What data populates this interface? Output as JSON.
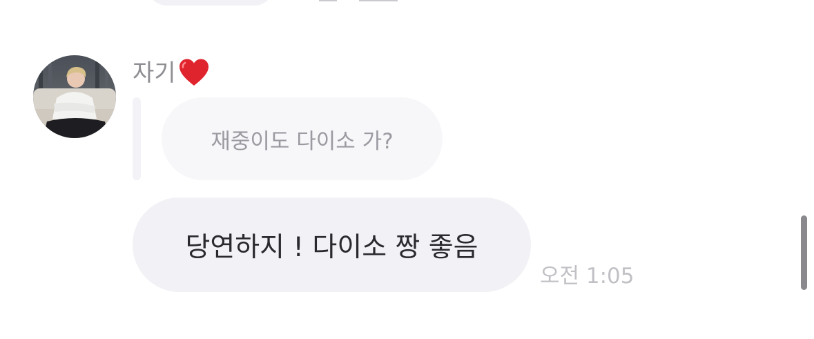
{
  "sender": {
    "name": "자기",
    "emoji": "heart-icon",
    "avatar_icon": "user-avatar"
  },
  "reply": {
    "quoted_text": "재중이도 다이소 가?"
  },
  "message": {
    "text": "당연하지 ! 다이소 짱 좋음",
    "time": "오전 1:05"
  },
  "colors": {
    "bubble": "#f2f2f6",
    "quoted_bubble": "#f7f7fa",
    "meta_text": "#8e8e93",
    "timestamp": "#c0c0c5",
    "heart": "#e0242e"
  }
}
